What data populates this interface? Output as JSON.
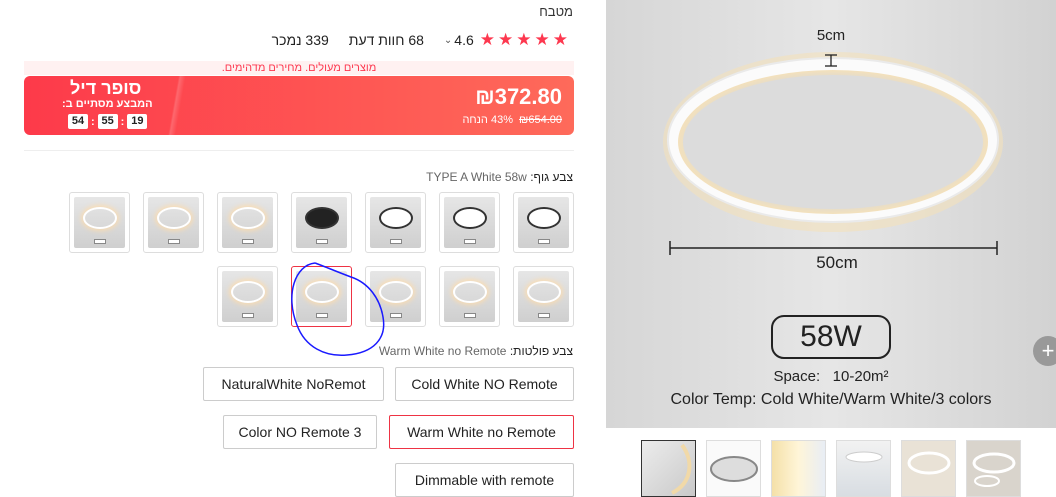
{
  "breadcrumb": "מטבח",
  "rating": {
    "stars": 5,
    "score": "4.6",
    "reviews": "68 חוות דעת",
    "sold": "339 נמכר"
  },
  "notice": "מוצרים מעולים. מחירים מדהימים.",
  "deal": {
    "price": "₪372.80",
    "old_price": "₪654.00",
    "discount": "43% הנחה",
    "title": "סופר דיל",
    "ends_label": "המבצע מסתיים ב:",
    "timer": {
      "h": "19",
      "m": "55",
      "s": "54"
    }
  },
  "body_color": {
    "label": "צבע גוף:",
    "value": "TYPE A White 58w"
  },
  "color_temp": {
    "label": "צבע פולטות:",
    "value": "Warm White no Remote",
    "options": [
      "Cold White NO Remote",
      "NaturalWhite NoRemot",
      "Warm White no Remote",
      "Color NO Remote 3",
      "Dimmable with remote"
    ]
  },
  "product_image": {
    "dim_top": "5cm",
    "dim_width": "50cm",
    "wattage": "58W",
    "space_label": "Space:",
    "space_value": "10-20m²",
    "color_temp": "Color Temp: Cold White/Warm White/3 colors"
  },
  "expand_icon": "+",
  "colors": {
    "accent": "#fd384f",
    "deal_start": "#fd3a4a",
    "deal_end": "#fe6a5a"
  }
}
